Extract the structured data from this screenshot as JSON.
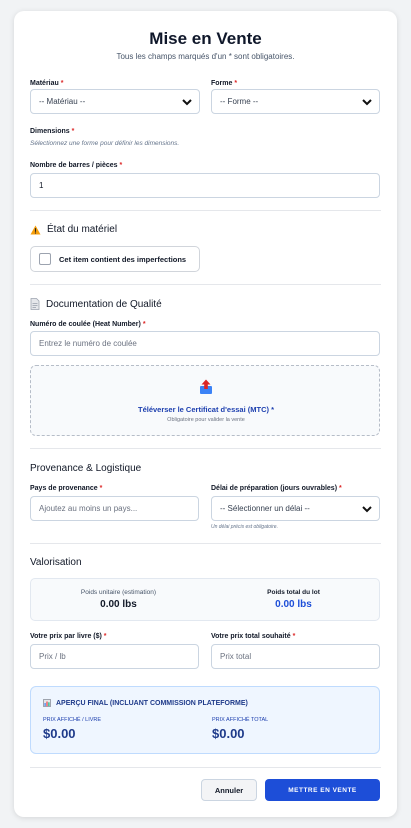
{
  "header": {
    "title": "Mise en Vente",
    "subtitle": "Tous les champs marqués d'un * sont obligatoires."
  },
  "material": {
    "label": "Matériau",
    "value": "-- Matériau --"
  },
  "shape": {
    "label": "Forme",
    "value": "-- Forme --"
  },
  "dimensions": {
    "label": "Dimensions",
    "hint": "Sélectionnez une forme pour définir les dimensions."
  },
  "bars": {
    "label": "Nombre de barres / pièces",
    "value": "1"
  },
  "condition": {
    "title": "État du matériel",
    "checkbox_label": "Cet item contient des imperfections"
  },
  "quality": {
    "title": "Documentation de Qualité",
    "heat_label": "Numéro de coulée (Heat Number)",
    "heat_placeholder": "Entrez le numéro de coulée",
    "upload_label": "Téléverser le Certificat d'essai (MTC) *",
    "upload_hint": "Obligatoire pour valider la vente"
  },
  "logistics": {
    "title": "Provenance & Logistique",
    "country_label": "Pays de provenance",
    "country_placeholder": "Ajoutez au moins un pays...",
    "lead_label": "Délai de préparation (jours ouvrables)",
    "lead_value": "-- Sélectionner un délai --",
    "lead_hint": "Un délai précis est obligatoire."
  },
  "valuation": {
    "title": "Valorisation",
    "unit_weight_label": "Poids unitaire (estimation)",
    "unit_weight_value": "0.00 lbs",
    "total_weight_label": "Poids total du lot",
    "total_weight_value": "0.00 lbs",
    "price_per_lb_label": "Votre prix par livre ($)",
    "price_per_lb_placeholder": "Prix / lb",
    "total_price_label": "Votre prix total souhaité",
    "total_price_placeholder": "Prix total"
  },
  "preview": {
    "title": "APERÇU FINAL (INCLUANT COMMISSION PLATEFORME)",
    "per_lb_label": "PRIX AFFICHÉ / LIVRE",
    "per_lb_value": "$0.00",
    "total_label": "PRIX AFFICHÉ TOTAL",
    "total_value": "$0.00"
  },
  "actions": {
    "cancel_label": "Annuler",
    "submit_label": "METTRE EN VENTE"
  },
  "required_mark": "*",
  "colors": {
    "accent": "#1d4ed8",
    "required": "#dc2626",
    "warning": "#f59e0b"
  }
}
